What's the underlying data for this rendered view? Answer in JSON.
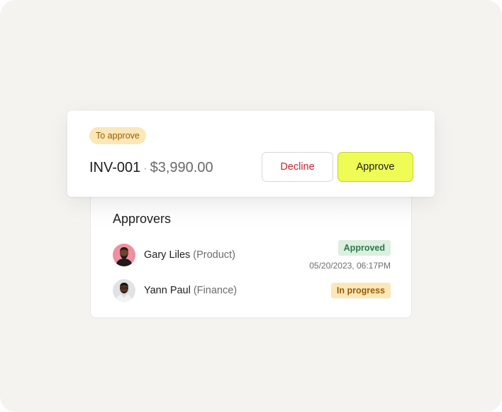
{
  "invoice": {
    "status_tag": "To approve",
    "id": "INV-001",
    "separator": "·",
    "amount": "$3,990.00",
    "decline_label": "Decline",
    "approve_label": "Approve"
  },
  "approvers": {
    "title": "Approvers",
    "items": [
      {
        "name": "Gary Liles",
        "department": "(Product)",
        "status": "Approved",
        "timestamp": "05/20/2023, 06:17PM",
        "status_color": "#2d7a4a"
      },
      {
        "name": "Yann Paul",
        "department": "(Finance)",
        "status": "In progress",
        "status_color": "#9a5c06"
      }
    ]
  },
  "colors": {
    "approve_accent": "#eefc55",
    "decline_text": "#c8262c",
    "pending_tag_bg": "#fbe7b8",
    "approved_tag_bg": "#dcefe1"
  }
}
